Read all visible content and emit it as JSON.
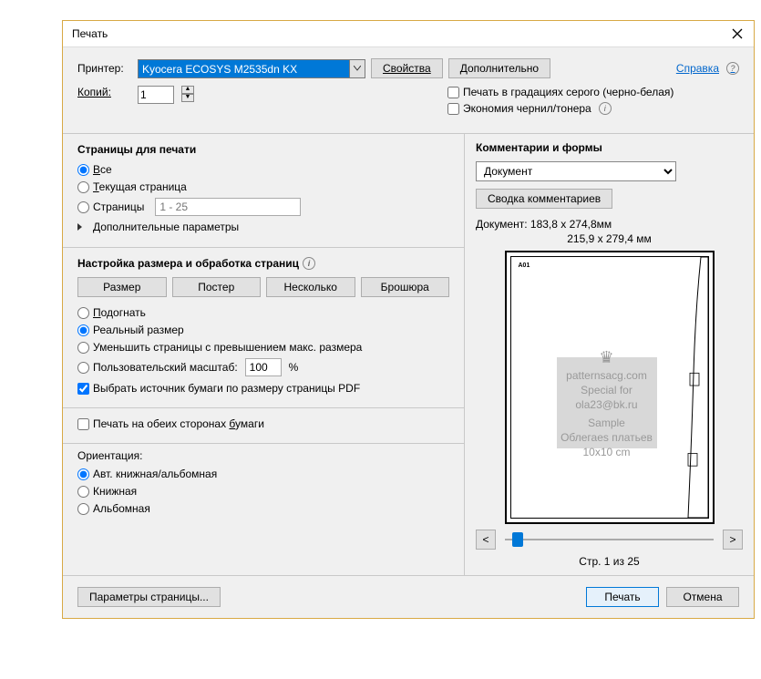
{
  "title": "Печать",
  "printer": {
    "label": "Принтер:",
    "value": "Kyocera ECOSYS M2535dn KX"
  },
  "buttons": {
    "properties": "Свойства",
    "advanced": "Дополнительно",
    "help": "Справка"
  },
  "copies": {
    "label": "Копий:",
    "value": "1"
  },
  "options": {
    "grayscale": "Печать в градациях серого (черно-белая)",
    "savetoner": "Экономия чернил/тонера"
  },
  "pages": {
    "title": "Страницы для печати",
    "all": "Все",
    "current": "Текущая страница",
    "pages_label": "Страницы",
    "pages_placeholder": "1 - 25",
    "more": "Дополнительные параметры"
  },
  "sizing": {
    "title": "Настройка размера и обработка страниц",
    "size": "Размер",
    "poster": "Постер",
    "multiple": "Несколько",
    "booklet": "Брошюра",
    "fit": "Подогнать",
    "actual": "Реальный размер",
    "shrink": "Уменьшить страницы с превышением макс. размера",
    "custom": "Пользовательский масштаб:",
    "custom_val": "100",
    "percent": "%",
    "papersource": "Выбрать источник бумаги по размеру страницы PDF"
  },
  "duplex": {
    "label": "Печать на обеих сторонах бумаги"
  },
  "orientation": {
    "title": "Ориентация:",
    "auto": "Авт. книжная/альбомная",
    "portrait": "Книжная",
    "landscape": "Альбомная"
  },
  "comments": {
    "title": "Комментарии и формы",
    "value": "Документ",
    "summary": "Сводка комментариев"
  },
  "preview": {
    "doc": "Документ: 183,8 x 274,8мм",
    "sheet": "215,9 x 279,4 мм",
    "tile": "A01",
    "wm1": "patternsacg.com",
    "wm2": "Special for",
    "wm3": "ola23@bk.ru",
    "wm4": "Sample",
    "wm5": "Облегаes платьев",
    "wm6": "10x10 cm",
    "pager": "Стр. 1 из 25"
  },
  "footer": {
    "pagesetup": "Параметры страницы...",
    "print": "Печать",
    "cancel": "Отмена"
  }
}
